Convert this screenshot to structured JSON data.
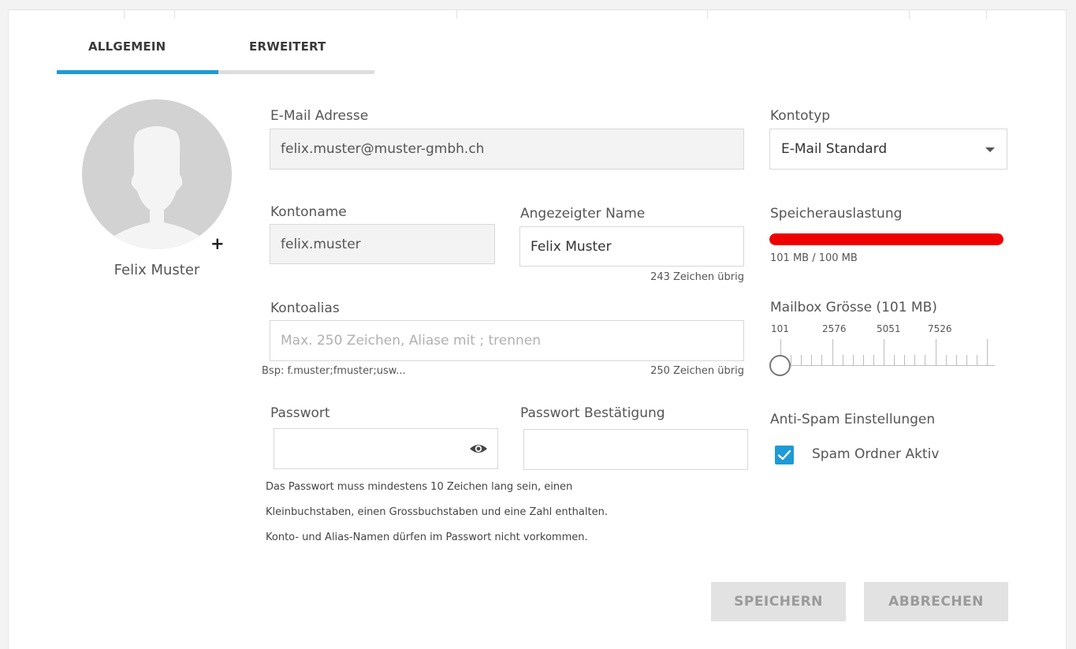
{
  "tabs": [
    {
      "label": "ALLGEMEIN",
      "active": true
    },
    {
      "label": "ERWEITERT",
      "active": false
    }
  ],
  "accent_color": "#1e9ad6",
  "avatar": {
    "name": "Felix Muster",
    "add_symbol": "+",
    "icon": "user-silhouette-icon"
  },
  "email": {
    "label": "E-Mail Adresse",
    "value": "felix.muster@muster-gmbh.ch"
  },
  "account_name": {
    "label": "Kontoname",
    "value": "felix.muster"
  },
  "display_name": {
    "label": "Angezeigter Name",
    "value": "Felix Muster",
    "remaining": "243 Zeichen übrig"
  },
  "alias": {
    "label": "Kontoalias",
    "placeholder": "Max. 250 Zeichen, Aliase mit ; trennen",
    "example": "Bsp: f.muster;fmuster;usw...",
    "remaining": "250 Zeichen übrig"
  },
  "password": {
    "label": "Passwort",
    "value": "",
    "icon": "eye-icon"
  },
  "password_confirm": {
    "label": "Passwort Bestätigung",
    "value": ""
  },
  "password_rules": [
    "Das Passwort muss mindestens 10 Zeichen lang sein, einen",
    "Kleinbuchstaben, einen Grossbuchstaben und eine Zahl enthalten.",
    "Konto- und Alias-Namen dürfen im Passwort nicht vorkommen."
  ],
  "account_type": {
    "label": "Kontotyp",
    "value": "E-Mail Standard",
    "icon": "caret-down-icon"
  },
  "storage": {
    "label": "Speicherauslastung",
    "text": "101 MB / 100 MB",
    "fill": 1.0,
    "color": "#ee0000"
  },
  "mailbox_size": {
    "label": "Mailbox Grösse (101 MB)",
    "ticks": [
      "101",
      "2576",
      "5051",
      "7526"
    ],
    "value": 101
  },
  "antispam": {
    "label": "Anti-Spam Einstellungen",
    "option": "Spam Ordner Aktiv",
    "checked": true
  },
  "buttons": {
    "save": "SPEICHERN",
    "cancel": "ABBRECHEN"
  }
}
